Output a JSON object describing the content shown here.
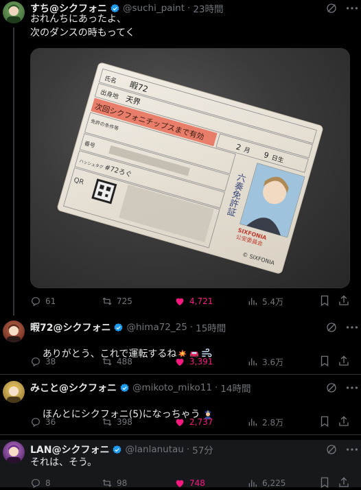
{
  "thread": [
    {
      "display_name": "すち@シクフォニ",
      "handle": "@suchi_paint",
      "time": "23時間",
      "text": "おれんちにあったよ、\n次のダンスの時もってく",
      "replies": "61",
      "reposts": "725",
      "likes": "4,721",
      "views": "5.4万",
      "avatar_color": "#3e6b3a"
    },
    {
      "display_name": "暇72@シクフォニ",
      "handle": "@hima72_25",
      "time": "15時間",
      "text": "ありがとう、これで運転するね",
      "replies": "38",
      "reposts": "488",
      "likes": "3,391",
      "views": "3.6万",
      "avatar_color": "#8a3a2e"
    },
    {
      "display_name": "みこと@シクフォニ",
      "handle": "@mikoto_miko11",
      "time": "14時間",
      "text": "ほんとにシクフォニ(5)になっちゃう",
      "replies": "36",
      "reposts": "398",
      "likes": "2,737",
      "views": "2.8万",
      "avatar_color": "#c6a23a"
    },
    {
      "display_name": "LAN@シクフォニ",
      "handle": "@lanlanutau",
      "time": "57分",
      "text": "それは、そう。",
      "replies": "8",
      "reposts": "98",
      "likes": "748",
      "views": "6,225",
      "avatar_color": "#7b2f8f"
    }
  ],
  "license_card": {
    "name_label": "氏名",
    "name": "暇72",
    "birthplace_label": "出身地",
    "birthplace": "天界",
    "validity": "次回シクフォニチップスまで有効",
    "birth_month": "2",
    "birth_month_unit": "月",
    "birth_day": "9",
    "birth_day_unit": "日生",
    "conditions_label": "免許の条件等",
    "number_label": "番号",
    "hashtag_label": "ハッシュタグ",
    "hashtag": "#72ろぐ",
    "qr_label": "QR",
    "vertical_title": "六奏免許証",
    "org": "SIXFONIA",
    "org_sub": "公安委員会",
    "copyright": "© SIXFONIA"
  },
  "colors": {
    "accent_like": "#f91880",
    "verified": "#1d9bf0",
    "muted": "#71767b",
    "card_bar": "#e87e6a"
  },
  "icons": [
    "reply-icon",
    "repost-icon",
    "like-icon",
    "views-icon",
    "bookmark-icon",
    "share-icon",
    "grok-icon",
    "more-icon",
    "verified-icon"
  ]
}
